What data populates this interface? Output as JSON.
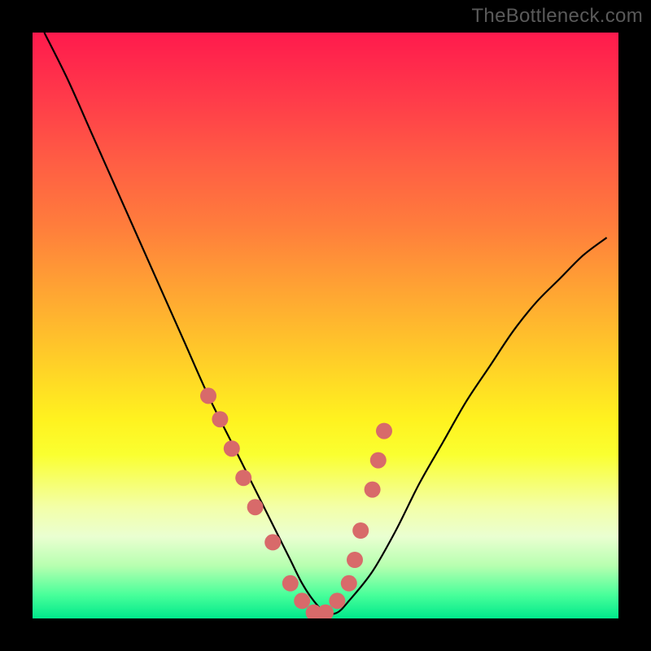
{
  "watermark": "TheBottleneck.com",
  "chart_data": {
    "type": "line",
    "title": "",
    "xlabel": "",
    "ylabel": "",
    "xlim": [
      0,
      100
    ],
    "ylim": [
      0,
      100
    ],
    "grid": false,
    "background": "rainbow-gradient",
    "series": [
      {
        "name": "bottleneck-curve",
        "x": [
          2,
          6,
          10,
          14,
          18,
          22,
          26,
          30,
          34,
          38,
          42,
          44,
          46,
          48,
          50,
          52,
          54,
          58,
          62,
          66,
          70,
          74,
          78,
          82,
          86,
          90,
          94,
          98
        ],
        "y": [
          100,
          92,
          83,
          74,
          65,
          56,
          47,
          38,
          30,
          22,
          14,
          10,
          6,
          3,
          1,
          1,
          3,
          8,
          15,
          23,
          30,
          37,
          43,
          49,
          54,
          58,
          62,
          65
        ]
      }
    ],
    "scatter_points": {
      "name": "highlight-points",
      "color": "#d86a6a",
      "x": [
        30,
        32,
        34,
        36,
        38,
        41,
        44,
        46,
        48,
        50,
        52,
        54,
        55,
        56,
        58,
        59,
        60
      ],
      "y": [
        38,
        34,
        29,
        24,
        19,
        13,
        6,
        3,
        1,
        1,
        3,
        6,
        10,
        15,
        22,
        27,
        32
      ]
    }
  }
}
